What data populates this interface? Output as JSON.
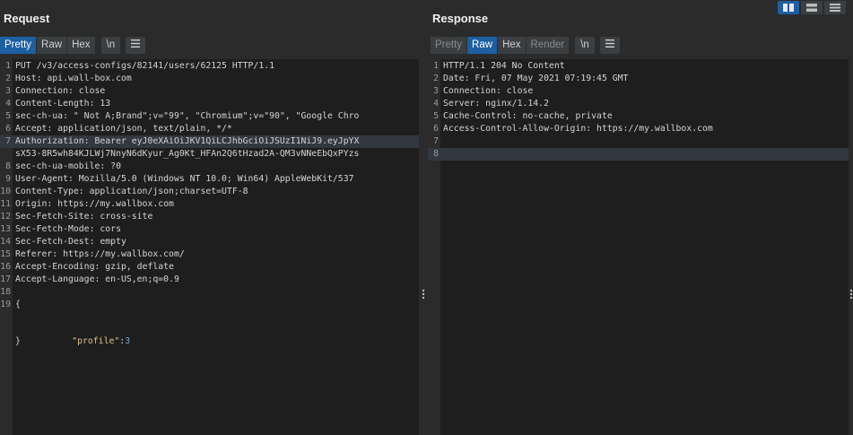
{
  "request": {
    "title": "Request",
    "tabs": [
      {
        "label": "Pretty",
        "active": true
      },
      {
        "label": "Raw",
        "active": false
      },
      {
        "label": "Hex",
        "active": false
      }
    ],
    "newline_label": "\\n",
    "menu_icon": "hamburger-menu-icon",
    "lines": [
      {
        "n": "1",
        "text": "PUT /v3/access-configs/82141/users/62125 HTTP/1.1"
      },
      {
        "n": "2",
        "text": "Host: api.wall-box.com"
      },
      {
        "n": "3",
        "text": "Connection: close"
      },
      {
        "n": "4",
        "text": "Content-Length: 13"
      },
      {
        "n": "5",
        "text": "sec-ch-ua: \" Not A;Brand\";v=\"99\", \"Chromium\";v=\"90\", \"Google Chro"
      },
      {
        "n": "6",
        "text": "Accept: application/json, text/plain, */*"
      },
      {
        "n": "7",
        "text": "Authorization: Bearer eyJ0eXAiOiJKV1QiLCJhbGciOiJSUzI1NiJ9.eyJpYX"
      },
      {
        "n": "",
        "text": "sX53-8R5wh84KJLWj7NnyN6dKyur_Ag0Kt_HFAn2Q6tHzad2A-QM3vNNeEbQxPYzs"
      },
      {
        "n": "8",
        "text": "sec-ch-ua-mobile: ?0"
      },
      {
        "n": "9",
        "text": "User-Agent: Mozilla/5.0 (Windows NT 10.0; Win64) AppleWebKit/537"
      },
      {
        "n": "10",
        "text": "Content-Type: application/json;charset=UTF-8"
      },
      {
        "n": "11",
        "text": "Origin: https://my.wallbox.com"
      },
      {
        "n": "12",
        "text": "Sec-Fetch-Site: cross-site"
      },
      {
        "n": "13",
        "text": "Sec-Fetch-Mode: cors"
      },
      {
        "n": "14",
        "text": "Sec-Fetch-Dest: empty"
      },
      {
        "n": "15",
        "text": "Referer: https://my.wallbox.com/"
      },
      {
        "n": "16",
        "text": "Accept-Encoding: gzip, deflate"
      },
      {
        "n": "17",
        "text": "Accept-Language: en-US,en;q=0.9"
      },
      {
        "n": "18",
        "text": ""
      },
      {
        "n": "19",
        "text": "{"
      }
    ],
    "body_key": "\"profile\"",
    "body_colon": ":",
    "body_value": "3",
    "body_close": "}"
  },
  "response": {
    "title": "Response",
    "tabs": [
      {
        "label": "Pretty",
        "active": false
      },
      {
        "label": "Raw",
        "active": true
      },
      {
        "label": "Hex",
        "active": false
      },
      {
        "label": "Render",
        "active": false
      }
    ],
    "newline_label": "\\n",
    "menu_icon": "hamburger-menu-icon",
    "lines": [
      {
        "n": "1",
        "text": "HTTP/1.1 204 No Content"
      },
      {
        "n": "2",
        "text": "Date: Fri, 07 May 2021 07:19:45 GMT"
      },
      {
        "n": "3",
        "text": "Connection: close"
      },
      {
        "n": "4",
        "text": "Server: nginx/1.14.2"
      },
      {
        "n": "5",
        "text": "Cache-Control: no-cache, private"
      },
      {
        "n": "6",
        "text": "Access-Control-Allow-Origin: https://my.wallbox.com"
      },
      {
        "n": "7",
        "text": ""
      },
      {
        "n": "8",
        "text": ""
      }
    ]
  },
  "layout_buttons": [
    "split-horizontal-icon",
    "split-vertical-icon",
    "single-pane-icon"
  ],
  "accent": "#1d5fa3"
}
